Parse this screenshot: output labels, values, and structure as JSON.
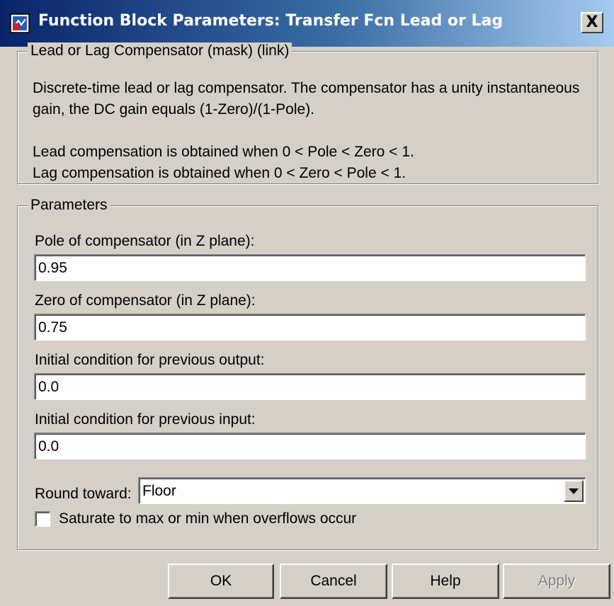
{
  "window": {
    "title": "Function Block Parameters: Transfer Fcn Lead or Lag",
    "close_label": "X"
  },
  "description": {
    "group_label": "Lead or Lag Compensator (mask) (link)",
    "line1": "Discrete-time lead or lag compensator.  The compensator has a unity instantaneous",
    "line2": "gain, the DC gain equals (1-Zero)/(1-Pole).",
    "line3": "Lead compensation is obtained when 0 < Pole < Zero < 1.",
    "line4": "Lag compensation is obtained when 0 < Zero < Pole < 1."
  },
  "parameters": {
    "group_label": "Parameters",
    "pole_label": "Pole of compensator (in Z plane):",
    "pole_value": "0.95",
    "zero_label": "Zero of compensator (in Z plane):",
    "zero_value": "0.75",
    "ic_output_label": "Initial condition for previous output:",
    "ic_output_value": "0.0",
    "ic_input_label": "Initial condition for previous input:",
    "ic_input_value": "0.0",
    "round_label": "Round toward:",
    "round_value": "Floor",
    "saturate_label": "Saturate to max or min when overflows occur",
    "saturate_checked": false
  },
  "buttons": {
    "ok": "OK",
    "cancel": "Cancel",
    "help": "Help",
    "apply": "Apply"
  },
  "colors": {
    "titlebar_start": "#0a246a",
    "titlebar_end": "#a6caf0",
    "dialog_face": "#d4d0c8",
    "disabled_text": "#808080"
  }
}
